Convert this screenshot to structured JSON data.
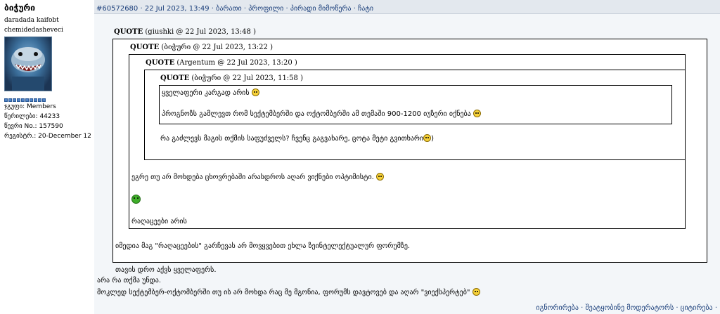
{
  "user": {
    "name": "ბიჭური",
    "line1": "daradada kaifobt",
    "line2": "chemidedasheveci",
    "group_label": "ჯგუფი:",
    "group_value": "Members",
    "posts_label": "წერილები:",
    "posts_value": "44233",
    "member_no_label": "წევრი No.:",
    "member_no_value": "157590",
    "registered_label": "რეგისტრ.:",
    "registered_value": "20-December 12"
  },
  "header": {
    "post_id": "#60572680",
    "date": "22 Jul 2023, 13:49",
    "links": [
      "ბარათი",
      "პროფილი",
      "პირადი მიმოწერა",
      "ჩატი"
    ]
  },
  "quotes": {
    "q1_label": "QUOTE",
    "q1_meta": "(giushki @ 22 Jul 2023, 13:48 )",
    "q2_label": "QUOTE",
    "q2_meta": "(ბიჭური @ 22 Jul 2023, 13:22 )",
    "q3_label": "QUOTE",
    "q3_meta": "(Argentum @ 22 Jul 2023, 13:20 )",
    "q4_label": "QUOTE",
    "q4_meta": "(ბიჭური @ 22 Jul 2023, 11:58 )",
    "q4_line1": "ყველაფერი კარგად არის",
    "q4_line2": "პროგნოზს გამლევთ რომ სექტემბერში და ოქტომბერში ამ თემაში 900-1200 იუზერი იქნება",
    "q3_text": "რა გაძლევს მაგის თქმის საფუძველს? ჩვენც გაგვახარე, ცოტა მეტი გვითხარი",
    "q2_line1": "ეგრე თუ არ მოხდება ცხოვრებაში არასდროს აღარ ვიქნები ოპტიმისტი.",
    "q2_line2": "რაღაცეები არის",
    "q1_line1": "იმედია მაგ \"რაღაცეების\" გარჩევას არ მოვყვებით ეხლა ზეინტელექტუალურ ფორუმზე.",
    "q1_line2": "თავის დრო აქვს ყველაფერს."
  },
  "post": {
    "line1": "არა რა თქმა უნდა.",
    "line2": "მოკლედ სექტემბერ-ოქტომბერში თუ ის არ მოხდა რაც მე მგონია, ფორუმს დავტოვებ და აღარ \"ვიექსპერტებ\""
  },
  "footer": {
    "ignore": "იგნორირება",
    "report": "შეატყობინე მოდერატორს",
    "quote": "ციტირება"
  }
}
